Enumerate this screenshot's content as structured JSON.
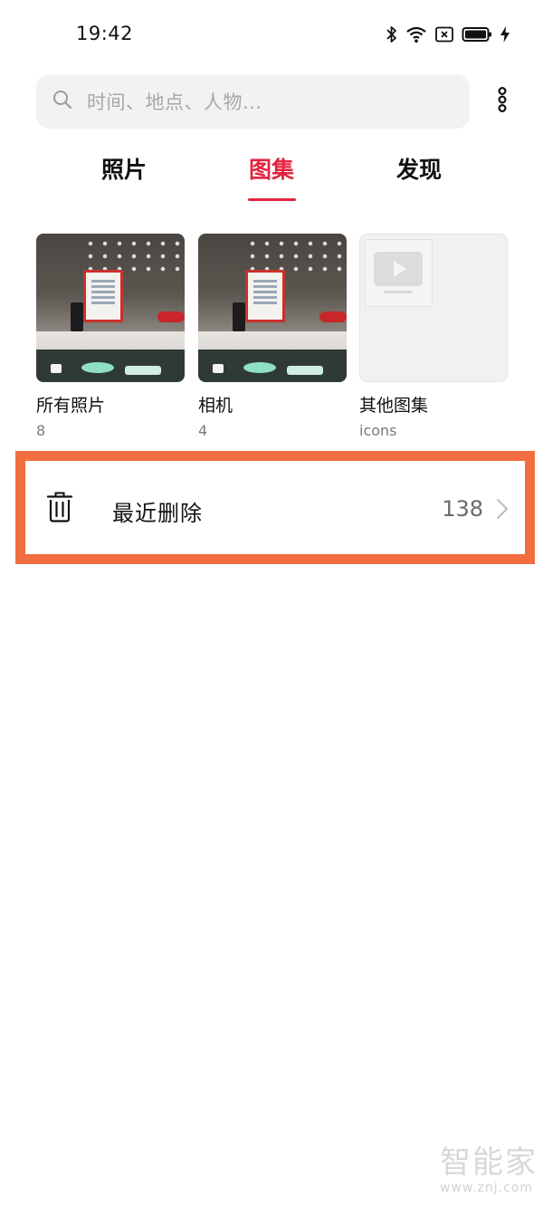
{
  "status_bar": {
    "time": "19:42",
    "icons": [
      "bluetooth-icon",
      "wifi-icon",
      "sim-disabled-icon",
      "battery-icon",
      "charging-icon"
    ]
  },
  "search": {
    "placeholder": "时间、地点、人物..."
  },
  "tabs": [
    {
      "label": "照片",
      "active": false
    },
    {
      "label": "图集",
      "active": true
    },
    {
      "label": "发现",
      "active": false
    }
  ],
  "albums": [
    {
      "name": "所有照片",
      "count": "8",
      "thumbnail": "store-photo"
    },
    {
      "name": "相机",
      "count": "4",
      "thumbnail": "store-photo"
    },
    {
      "name": "其他图集",
      "count": "icons",
      "thumbnail": "video-placeholder"
    }
  ],
  "recently_deleted": {
    "label": "最近删除",
    "count": "138",
    "highlight_color": "#f26d40"
  },
  "watermark": {
    "logo": "智能家",
    "url": "www.znj.com"
  },
  "colors": {
    "accent": "#e3233f",
    "search_bg": "#f2f2f2"
  }
}
